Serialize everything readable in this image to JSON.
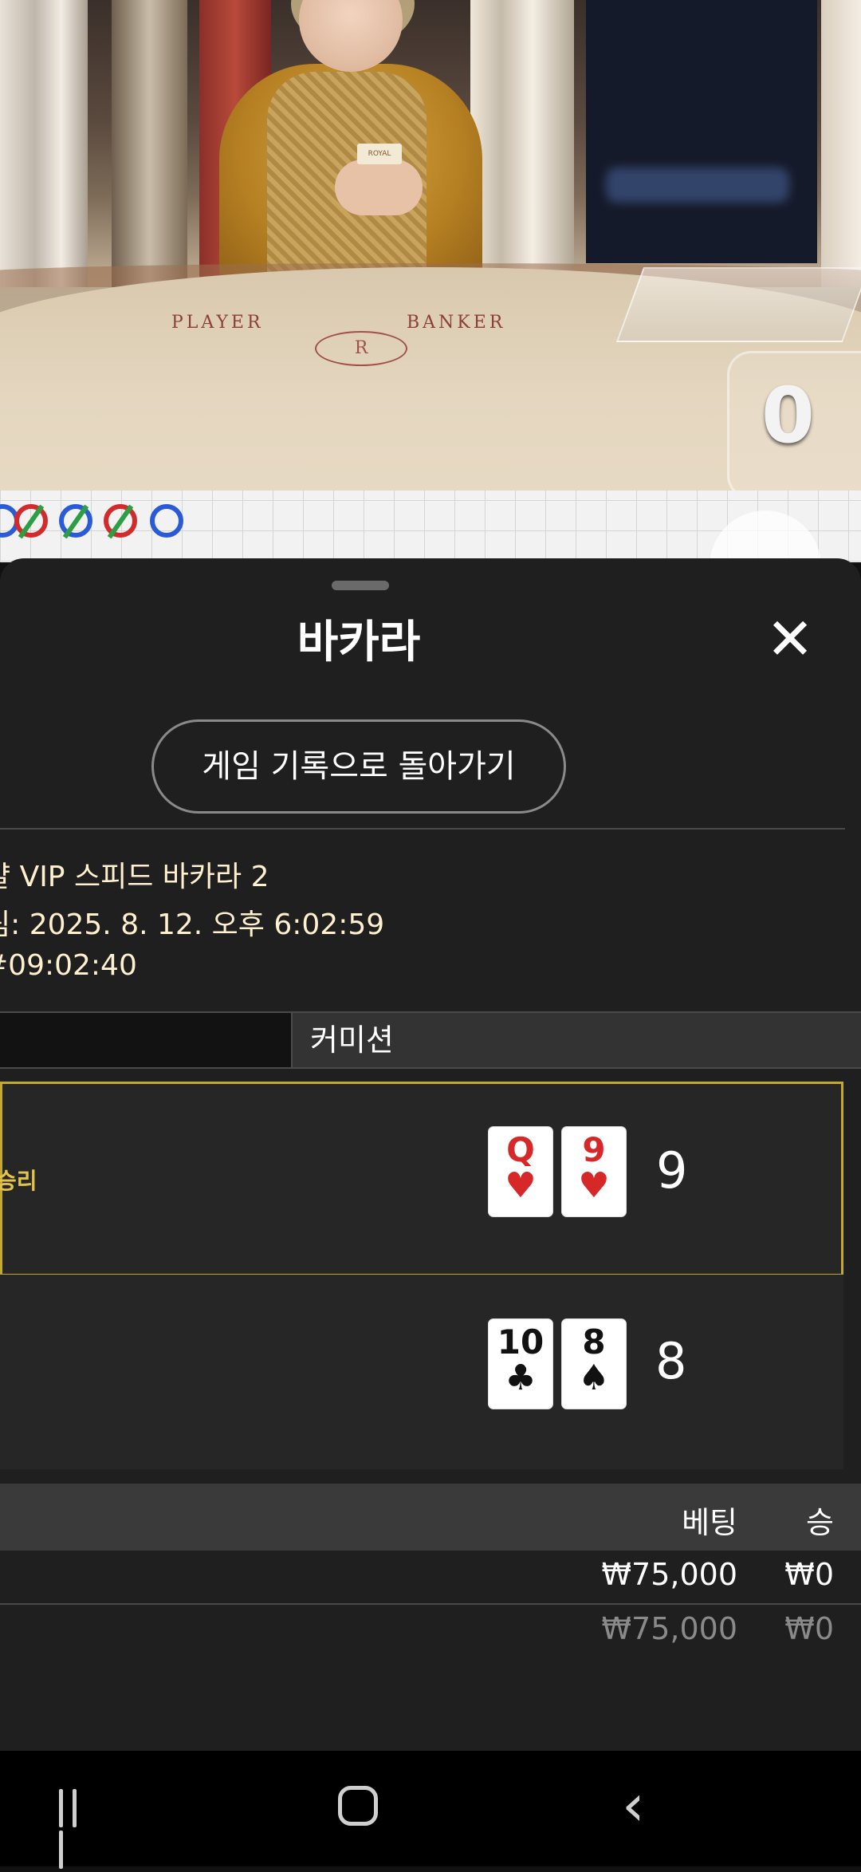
{
  "video": {
    "table_left_label": "PLAYER",
    "table_right_label": "BANKER",
    "emblem": "R",
    "dealer_badge": "ROYAL",
    "counter": "0"
  },
  "sheet": {
    "title": "바카라",
    "close_icon": "close-icon",
    "back_button_label": "게임 기록으로 돌아가기",
    "info_lines": [
      "얄 VIP 스피드 바카라 2",
      "림: 2025. 8. 12. 오후 6:02:59",
      "#09:02:40"
    ],
    "tab_commission": "커미션",
    "hands": [
      {
        "label": "승리",
        "cards": [
          {
            "rank": "Q",
            "suit": "♥",
            "color": "#d62828"
          },
          {
            "rank": "9",
            "suit": "♥",
            "color": "#d62828"
          }
        ],
        "score": "9"
      },
      {
        "label": "",
        "cards": [
          {
            "rank": "10",
            "suit": "♣",
            "color": "#111111"
          },
          {
            "rank": "8",
            "suit": "♠",
            "color": "#111111"
          }
        ],
        "score": "8"
      }
    ],
    "bets": {
      "header_bet": "베팅",
      "header_win": "승",
      "rows": [
        {
          "bet": "₩75,000",
          "win": "₩0"
        },
        {
          "bet": "₩75,000",
          "win": "₩0"
        }
      ]
    }
  },
  "navbar": {
    "recent_icon": "recent-apps-icon",
    "home_icon": "home-icon",
    "back_icon": "back-icon"
  }
}
